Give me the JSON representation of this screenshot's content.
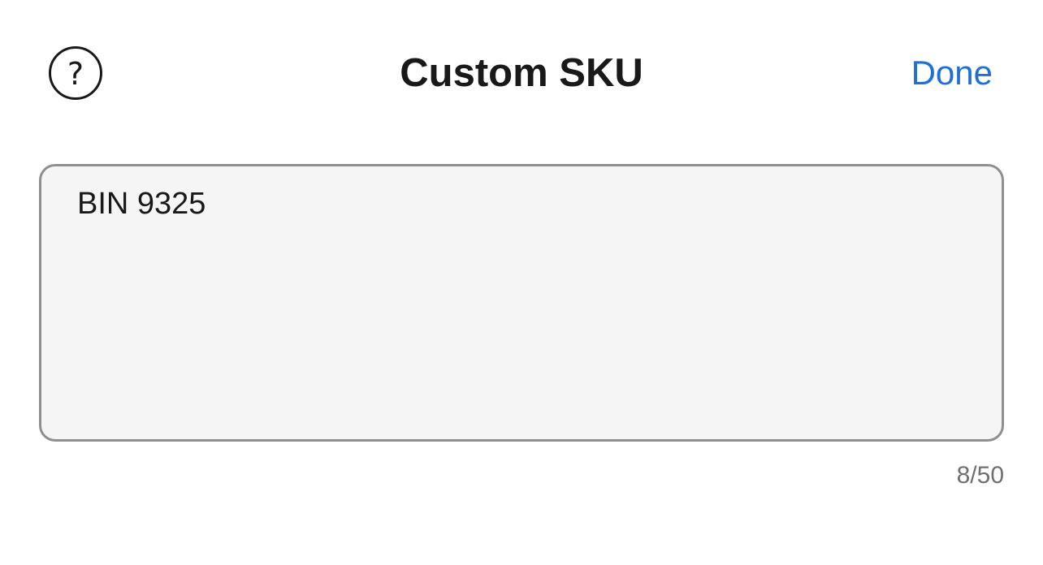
{
  "header": {
    "help_icon": "question-circle-icon",
    "help_glyph": "?",
    "title": "Custom SKU",
    "done_label": "Done"
  },
  "sku_input": {
    "value": "BIN 9325"
  },
  "counter": {
    "text": "8/50",
    "current": 8,
    "max": 50
  },
  "colors": {
    "accent": "#1f6fd4",
    "text": "#191919",
    "field_background": "#f5f5f5",
    "field_border": "#8f8f8f",
    "counter_text": "#707070"
  }
}
